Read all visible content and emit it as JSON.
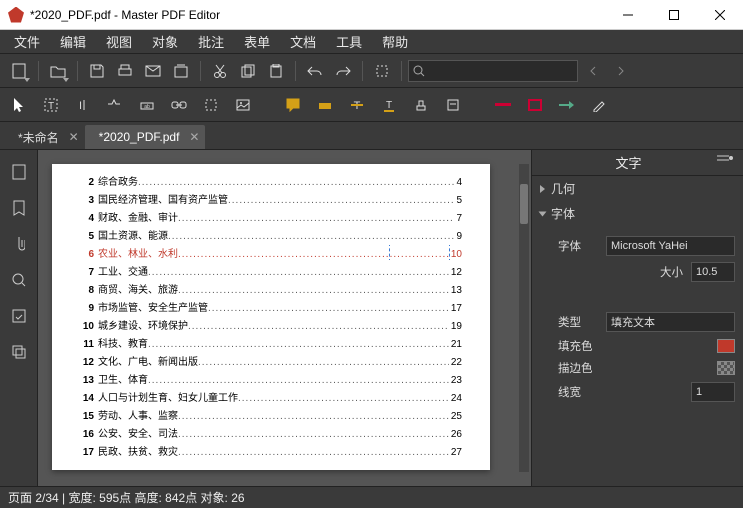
{
  "title": "*2020_PDF.pdf - Master PDF Editor",
  "menu": [
    "文件",
    "编辑",
    "视图",
    "对象",
    "批注",
    "表单",
    "文档",
    "工具",
    "帮助"
  ],
  "tabs": [
    {
      "label": "*未命名",
      "active": false
    },
    {
      "label": "*2020_PDF.pdf",
      "active": true
    }
  ],
  "toc": [
    {
      "n": "2",
      "t": "综合政务",
      "p": "4"
    },
    {
      "n": "3",
      "t": "国民经济管理、国有资产监管",
      "p": "5"
    },
    {
      "n": "4",
      "t": "财政、金融、审计",
      "p": "7"
    },
    {
      "n": "5",
      "t": "国土资源、能源",
      "p": "9"
    },
    {
      "n": "6",
      "t": "农业、林业、水利",
      "p": "10",
      "selected": true
    },
    {
      "n": "7",
      "t": "工业、交通",
      "p": "12"
    },
    {
      "n": "8",
      "t": "商贸、海关、旅游",
      "p": "13"
    },
    {
      "n": "9",
      "t": "市场监管、安全生产监管",
      "p": "17"
    },
    {
      "n": "10",
      "t": "城乡建设、环境保护",
      "p": "19"
    },
    {
      "n": "11",
      "t": "科技、教育",
      "p": "21"
    },
    {
      "n": "12",
      "t": "文化、广电、新闻出版",
      "p": "22"
    },
    {
      "n": "13",
      "t": "卫生、体育",
      "p": "23"
    },
    {
      "n": "14",
      "t": "人口与计划生育、妇女儿童工作",
      "p": "24"
    },
    {
      "n": "15",
      "t": "劳动、人事、监察",
      "p": "25"
    },
    {
      "n": "16",
      "t": "公安、安全、司法",
      "p": "26"
    },
    {
      "n": "17",
      "t": "民政、扶贫、救灾",
      "p": "27"
    }
  ],
  "panel": {
    "title": "文字",
    "sec_geom": "几何",
    "sec_font": "字体",
    "font_label": "字体",
    "font_value": "Microsoft YaHei",
    "size_label": "大小",
    "size_value": "10.5",
    "type_label": "类型",
    "type_value": "填充文本",
    "fill_label": "填充色",
    "fill_color": "#c0392b",
    "stroke_label": "描边色",
    "stroke_color": "transparent",
    "linewidth_label": "线宽",
    "linewidth_value": "1"
  },
  "status": "页面 2/34 | 宽度: 595点 高度: 842点 对象: 26"
}
